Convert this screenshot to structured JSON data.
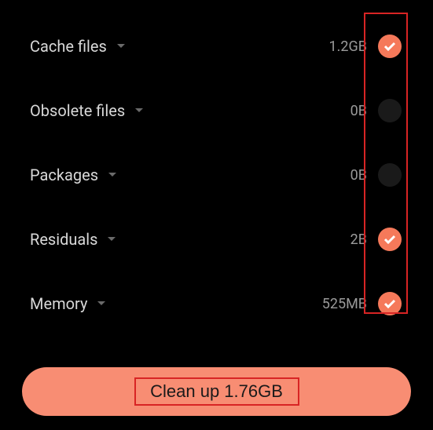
{
  "items": [
    {
      "label": "Cache files",
      "size": "1.2GB",
      "checked": true
    },
    {
      "label": "Obsolete files",
      "size": "0B",
      "checked": false
    },
    {
      "label": "Packages",
      "size": "0B",
      "checked": false
    },
    {
      "label": "Residuals",
      "size": "2B",
      "checked": true
    },
    {
      "label": "Memory",
      "size": "525MB",
      "checked": true
    }
  ],
  "button": {
    "label": "Clean up 1.76GB"
  },
  "colors": {
    "accent": "#f5795a",
    "button": "#f88d73",
    "highlight": "#d82424"
  }
}
